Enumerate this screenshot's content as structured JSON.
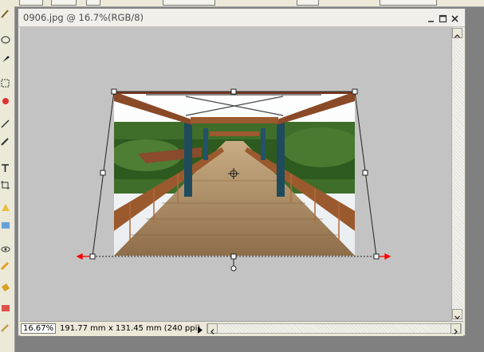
{
  "document": {
    "title": "0906.jpg @ 16.7%(RGB/8)",
    "window_controls": [
      "minimize-icon",
      "maximize-icon",
      "close-icon"
    ]
  },
  "status": {
    "zoom": "16.67%",
    "info": "191.77 mm x 131.45 mm (240 ppi)"
  },
  "tools": [
    "brush-icon",
    "lasso-icon",
    "pen-icon",
    "marquee-icon",
    "stamp-icon",
    "magic-wand-icon",
    "eyedropper-icon",
    "type-icon",
    "crop-icon",
    "slice-icon",
    "shape-icon",
    "print-icon",
    "eye-icon",
    "pencil-icon",
    "bucket-icon",
    "eraser-icon"
  ],
  "transform": {
    "mode": "perspective",
    "handles": [
      "top-left",
      "top-center",
      "top-right",
      "middle-left",
      "center",
      "middle-right",
      "bottom-left",
      "bottom-center",
      "bottom-right",
      "rotate-pivot"
    ]
  },
  "colors": {
    "canvas_bg": "#c3c3c3",
    "handle_arrows": "#ff0000"
  }
}
